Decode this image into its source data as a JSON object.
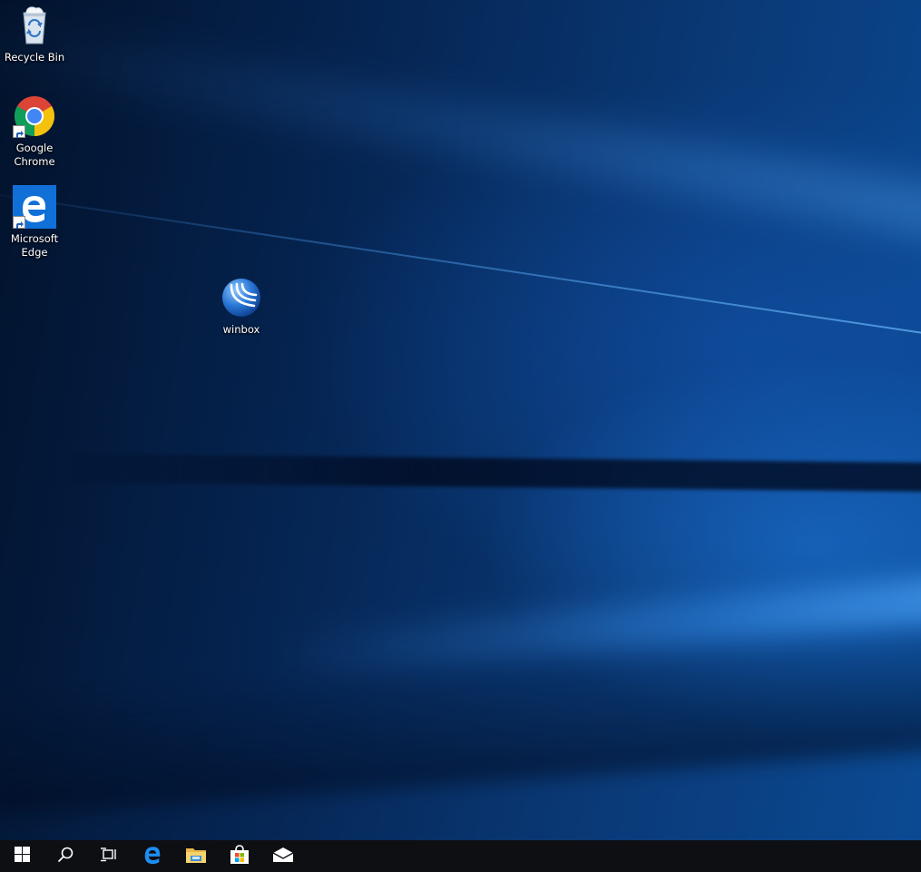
{
  "desktop": {
    "icons": [
      {
        "name": "recycle-bin",
        "label": "Recycle Bin",
        "icon": "recycle-bin-icon"
      },
      {
        "name": "google-chrome",
        "label": "Google Chrome",
        "icon": "chrome-icon",
        "shortcut": true
      },
      {
        "name": "microsoft-edge",
        "label": "Microsoft Edge",
        "icon": "edge-icon",
        "shortcut": true
      },
      {
        "name": "winbox",
        "label": "winbox",
        "icon": "winbox-icon"
      }
    ]
  },
  "taskbar": {
    "items": [
      {
        "name": "start-button",
        "icon": "windows-logo-icon"
      },
      {
        "name": "search-button",
        "icon": "search-icon"
      },
      {
        "name": "task-view-button",
        "icon": "task-view-icon"
      },
      {
        "name": "taskbar-edge",
        "icon": "edge-icon"
      },
      {
        "name": "taskbar-file-explorer",
        "icon": "folder-icon"
      },
      {
        "name": "taskbar-store",
        "icon": "store-bag-icon"
      },
      {
        "name": "taskbar-mail",
        "icon": "mail-icon"
      }
    ]
  },
  "colors": {
    "taskbar": "#0e0f13",
    "desktop_dark": "#02122b",
    "desktop_light": "#0b4a93",
    "edge_blue": "#1070d8"
  }
}
